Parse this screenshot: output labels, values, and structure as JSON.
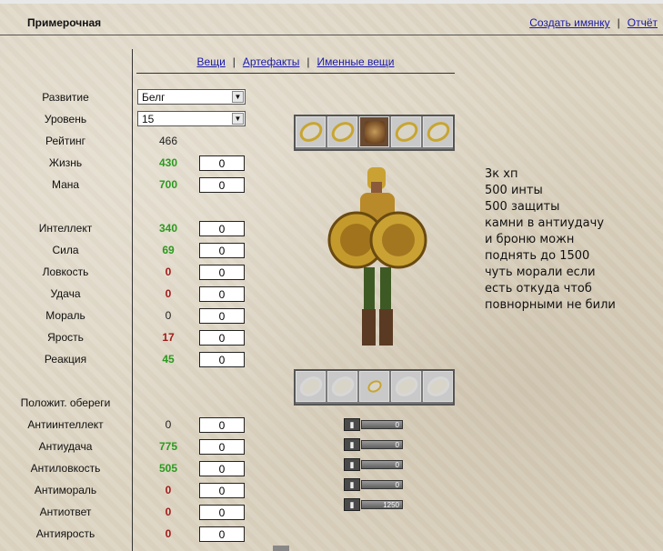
{
  "header": {
    "title": "Примерочная",
    "create_link": "Создать имянку",
    "separator": "|",
    "report_link": "Отчёт"
  },
  "tabs": [
    {
      "label": "Вещи"
    },
    {
      "label": "Артефакты"
    },
    {
      "label": "Именные вещи"
    }
  ],
  "selects": {
    "development": {
      "label": "Развитие",
      "value": "Белг"
    },
    "level": {
      "label": "Уровень",
      "value": "15"
    }
  },
  "rating": {
    "label": "Рейтинг",
    "value": "466"
  },
  "stats": [
    {
      "label": "Жизнь",
      "value": "430",
      "input": "0"
    },
    {
      "label": "Мана",
      "value": "700",
      "input": "0"
    },
    {
      "label": "Интеллект",
      "value": "340",
      "input": "0"
    },
    {
      "label": "Сила",
      "value": "69",
      "input": "0"
    },
    {
      "label": "Ловкость",
      "value": "0",
      "input": "0"
    },
    {
      "label": "Удача",
      "value": "0",
      "input": "0"
    },
    {
      "label": "Мораль",
      "value": "0",
      "input": "0"
    },
    {
      "label": "Ярость",
      "value": "17",
      "input": "0"
    },
    {
      "label": "Реакция",
      "value": "45",
      "input": "0"
    }
  ],
  "amulets_heading": "Положит. обереги",
  "amulets": [
    {
      "label": "Антиинтеллект",
      "value": "0",
      "input": "0"
    },
    {
      "label": "Антиудача",
      "value": "775",
      "input": "0"
    },
    {
      "label": "Антиловкость",
      "value": "505",
      "input": "0"
    },
    {
      "label": "Антимораль",
      "value": "0",
      "input": "0"
    },
    {
      "label": "Антиответ",
      "value": "0",
      "input": "0"
    },
    {
      "label": "Антиярость",
      "value": "0",
      "input": "0"
    }
  ],
  "equipment_bars": [
    {
      "icon": "bar-icon-1",
      "value": "0"
    },
    {
      "icon": "bar-icon-2",
      "value": "0"
    },
    {
      "icon": "bar-icon-3",
      "value": "0"
    },
    {
      "icon": "bar-icon-4",
      "value": "0"
    },
    {
      "icon": "bar-icon-5",
      "value": "1250"
    }
  ],
  "note_lines": [
    "3к хп",
    "500 инты",
    "500 защиты",
    "камни в антиудачу",
    "и броню можн",
    "поднять до 1500",
    "чуть морали если",
    "есть откуда чтоб",
    "повнорными не били"
  ],
  "colors": {
    "positive": "#2a9a1e",
    "negative": "#a11a1a",
    "link": "#1a1aa8"
  }
}
